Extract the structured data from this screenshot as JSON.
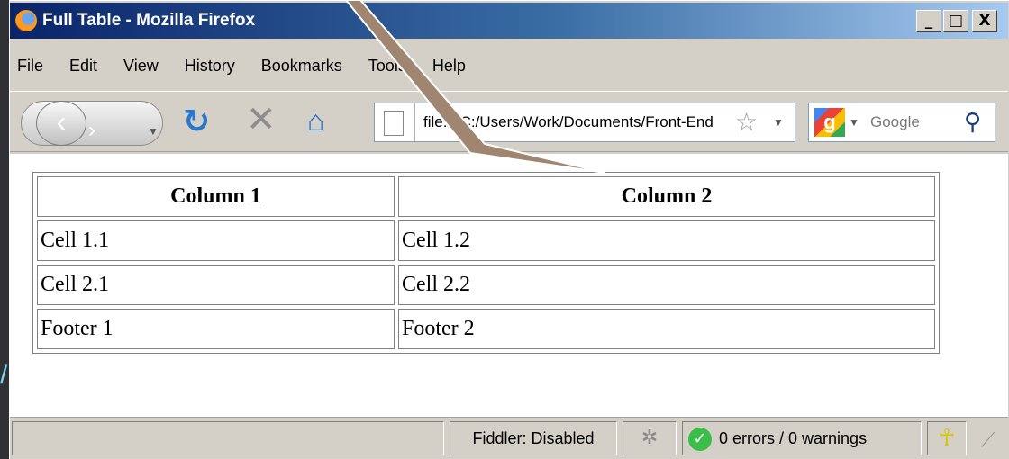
{
  "window": {
    "title": "Full Table - Mozilla Firefox",
    "minimize": "_",
    "maximize": "□",
    "close": "X"
  },
  "menu": [
    "File",
    "Edit",
    "View",
    "History",
    "Bookmarks",
    "Tools",
    "Help"
  ],
  "nav": {
    "url": "file:///C:/Users/Work/Documents/Front-End",
    "search_placeholder": "Google"
  },
  "table": {
    "headers": [
      "Column 1",
      "Column 2"
    ],
    "rows": [
      [
        "Cell 1.1",
        "Cell 1.2"
      ],
      [
        "Cell 2.1",
        "Cell 2.2"
      ],
      [
        "Footer 1",
        "Footer 2"
      ]
    ]
  },
  "status": {
    "fiddler": "Fiddler: Disabled",
    "errors": "0 errors / 0 warnings"
  },
  "colors": {
    "callout": "#a08670",
    "title_start": "#0a246a",
    "title_end": "#a6caf0"
  }
}
